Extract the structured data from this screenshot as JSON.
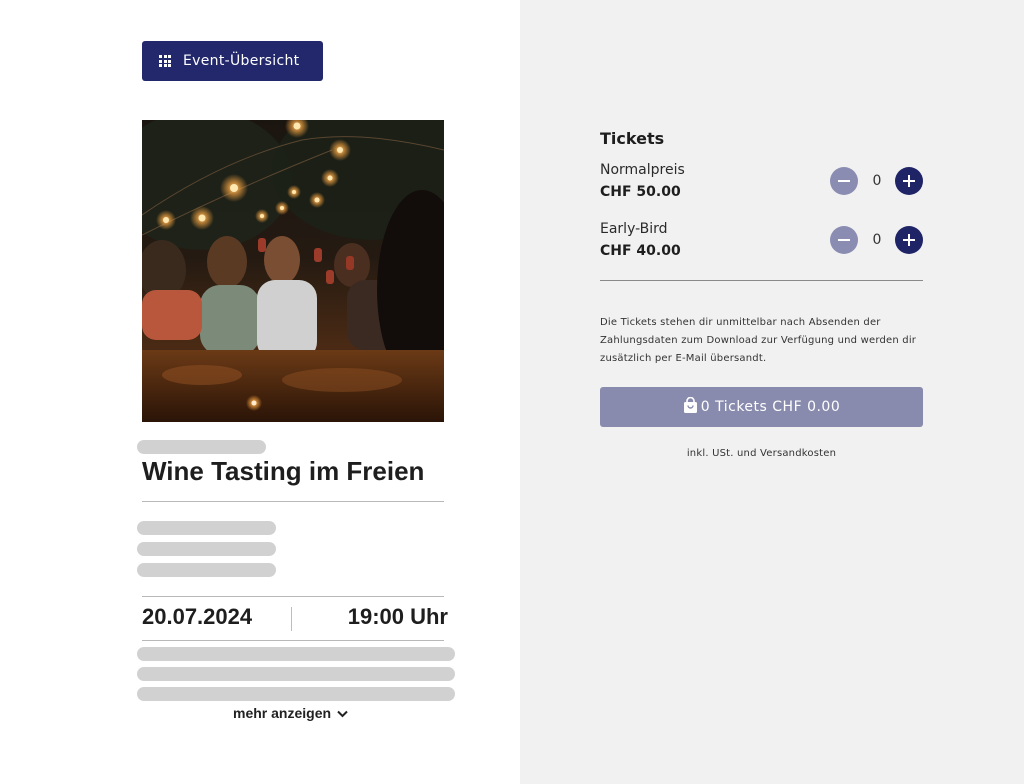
{
  "header": {
    "overview_button_label": "Event-Übersicht",
    "overview_icon": "grid-icon"
  },
  "event": {
    "image_alt": "Friends toasting with wine glasses under string lights",
    "title": "Wine Tasting im Freien",
    "date": "20.07.2024",
    "time": "19:00 Uhr",
    "more_label": "mehr anzeigen",
    "more_icon": "chevron-down-icon"
  },
  "tickets": {
    "heading": "Tickets",
    "items": [
      {
        "name": "Normalpreis",
        "price": "CHF 50.00",
        "quantity": "0"
      },
      {
        "name": "Early-Bird",
        "price": "CHF 40.00",
        "quantity": "0"
      }
    ],
    "info_text": "Die Tickets stehen dir unmittelbar nach Absenden der Zahlungsdaten zum Download zur Verfügung und werden dir zusätzlich per E-Mail übersandt.",
    "buy_button_label": "0 Tickets CHF 0.00",
    "buy_icon": "shopping-bag-icon",
    "footnote": "inkl. USt. und Versandkosten"
  },
  "colors": {
    "primary": "#22286b",
    "primary_disabled": "#888bad",
    "panel_background": "#f1f1f2",
    "skeleton": "#d1d1d1"
  }
}
